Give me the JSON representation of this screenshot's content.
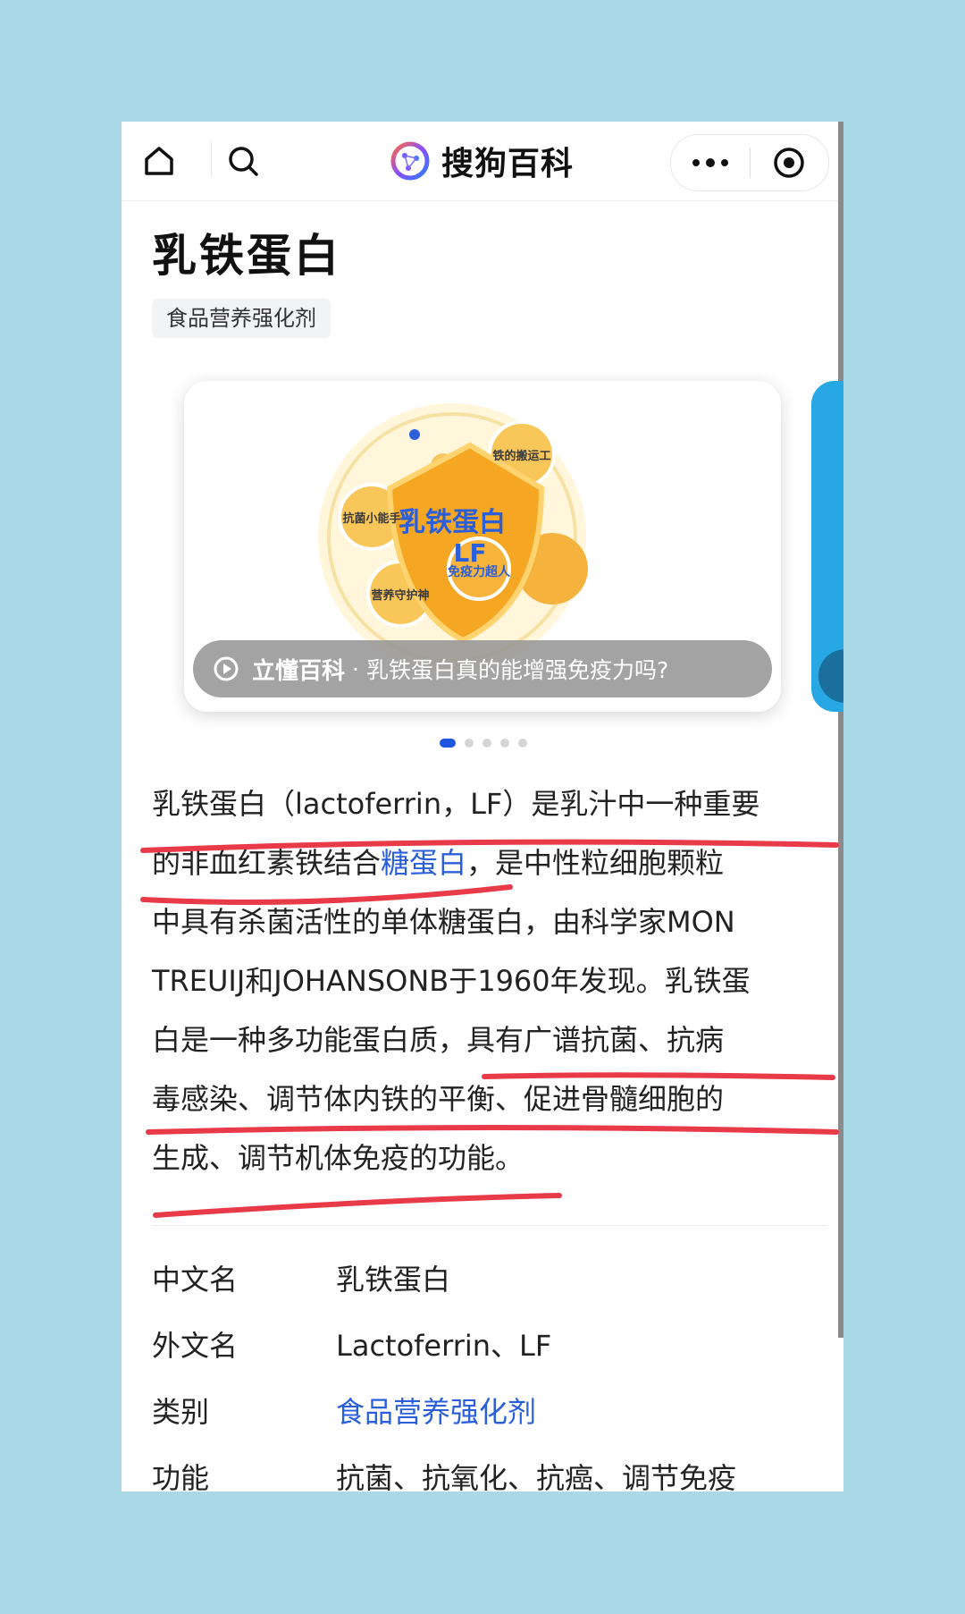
{
  "nav": {
    "brand": "搜狗百科"
  },
  "article": {
    "title": "乳铁蛋白",
    "tag": "食品营养强化剂"
  },
  "carousel": {
    "video_brand": "立懂百科",
    "video_sep": "·",
    "video_title": "乳铁蛋白真的能增强免疫力吗?",
    "image_labels": {
      "center": "乳铁蛋白",
      "center_sub": "LF",
      "iron": "铁的搬运工",
      "antibac": "抗菌小能手",
      "nutrition": "营养守护神",
      "immune": "免疫力超人"
    },
    "dots_total": 5,
    "active_index": 0
  },
  "summary": {
    "l1": "乳铁蛋白（lactoferrin，LF）是乳汁中一种重要",
    "l2a": "的非血红素铁结合",
    "l2link": "糖蛋白",
    "l2b": "，是中性粒细胞颗粒",
    "l3": "中具有杀菌活性的单体糖蛋白，由科学家MON",
    "l4": "TREUIJ和JOHANSONB于1960年发现。乳铁蛋",
    "l5": "白是一种多功能蛋白质，具有广谱抗菌、抗病",
    "l6": "毒感染、调节体内铁的平衡、促进骨髓细胞的",
    "l7": "生成、调节机体免疫的功能。"
  },
  "info": [
    {
      "key": "中文名",
      "value": "乳铁蛋白"
    },
    {
      "key": "外文名",
      "value": "Lactoferrin、LF"
    },
    {
      "key": "类别",
      "value": "食品营养强化剂"
    },
    {
      "key": "功能",
      "value": "抗菌、抗氧化、抗癌、调节免疫"
    }
  ],
  "colors": {
    "background": "#a9d9e6",
    "link": "#2b5fd9",
    "underline": "#e83a48",
    "active_dot": "#1e56e0"
  }
}
